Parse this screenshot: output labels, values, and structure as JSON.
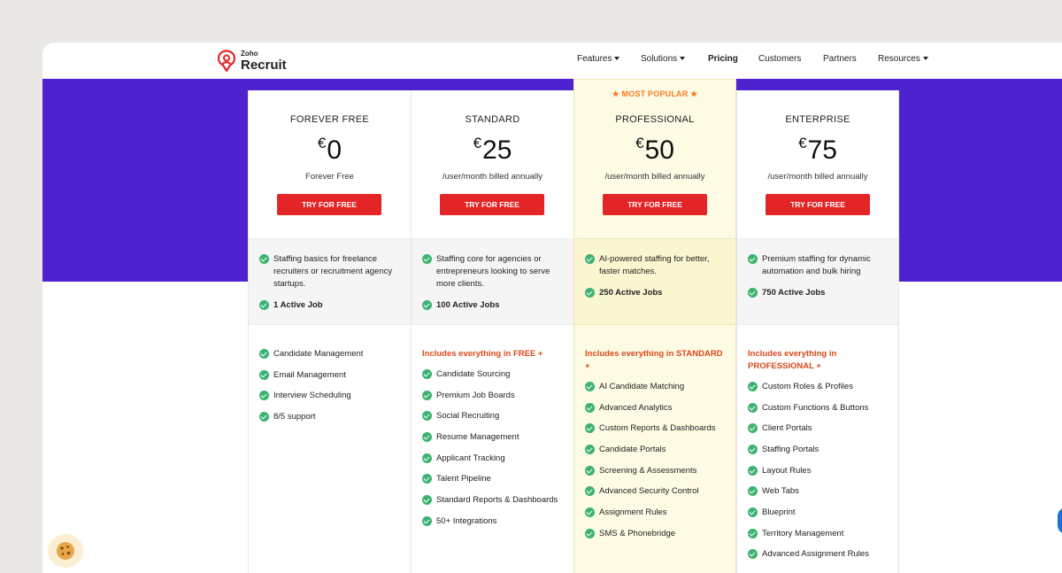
{
  "brand": {
    "small": "Zoho",
    "name": "Recruit"
  },
  "nav": [
    {
      "label": "Features",
      "dropdown": true,
      "active": false
    },
    {
      "label": "Solutions",
      "dropdown": true,
      "active": false
    },
    {
      "label": "Pricing",
      "dropdown": false,
      "active": true
    },
    {
      "label": "Customers",
      "dropdown": false,
      "active": false
    },
    {
      "label": "Partners",
      "dropdown": false,
      "active": false
    },
    {
      "label": "Resources",
      "dropdown": true,
      "active": false
    }
  ],
  "colors": {
    "hero": "#4f22d0",
    "cta": "#e42527",
    "check": "#3cb371",
    "includes": "#d9481b",
    "popular": "#f47a20",
    "popular_bg": "#fefbe5"
  },
  "plans": [
    {
      "name": "FOREVER FREE",
      "currency": "€",
      "price": "0",
      "billing": "Forever Free",
      "cta": "TRY FOR FREE",
      "summary": [
        "Staffing basics for freelance recruiters or recruitment agency startups."
      ],
      "jobs": "1 Active Job",
      "includes": "",
      "features": [
        "Candidate Management",
        "Email Management",
        "Interview Scheduling",
        "8/5 support"
      ]
    },
    {
      "name": "STANDARD",
      "currency": "€",
      "price": "25",
      "billing": "/user/month billed annually",
      "cta": "TRY FOR FREE",
      "summary": [
        "Staffing core for agencies or entrepreneurs looking to serve more clients."
      ],
      "jobs": "100 Active Jobs",
      "includes": "Includes everything in FREE +",
      "features": [
        "Candidate Sourcing",
        "Premium Job Boards",
        "Social Recruiting",
        "Resume Management",
        "Applicant Tracking",
        "Talent Pipeline",
        "Standard Reports & Dashboards",
        "50+ Integrations"
      ]
    },
    {
      "badge": "★ MOST POPULAR ★",
      "name": "PROFESSIONAL",
      "currency": "€",
      "price": "50",
      "billing": "/user/month billed annually",
      "cta": "TRY FOR FREE",
      "summary": [
        "AI-powered staffing for better, faster matches."
      ],
      "jobs": "250 Active Jobs",
      "includes": "Includes everything in STANDARD +",
      "features": [
        "AI Candidate Matching",
        "Advanced Analytics",
        "Custom Reports & Dashboards",
        "Candidate Portals",
        "Screening & Assessments",
        "Advanced Security Control",
        "Assignment Rules",
        "SMS & Phonebridge"
      ]
    },
    {
      "name": "ENTERPRISE",
      "currency": "€",
      "price": "75",
      "billing": "/user/month billed annually",
      "cta": "TRY FOR FREE",
      "summary": [
        "Premium staffing for dynamic automation and bulk hiring"
      ],
      "jobs": "750 Active Jobs",
      "includes": "Includes everything in PROFESSIONAL +",
      "features": [
        "Custom Roles & Profiles",
        "Custom Functions & Buttons",
        "Client Portals",
        "Staffing Portals",
        "Layout Rules",
        "Web Tabs",
        "Blueprint",
        "Territory Management",
        "Advanced Assignment Rules"
      ]
    }
  ],
  "icons": {
    "logo": "zoho-recruit-logo-icon",
    "check": "check-circle-icon",
    "cookie": "cookie-icon",
    "chat": "chat-widget-icon"
  }
}
